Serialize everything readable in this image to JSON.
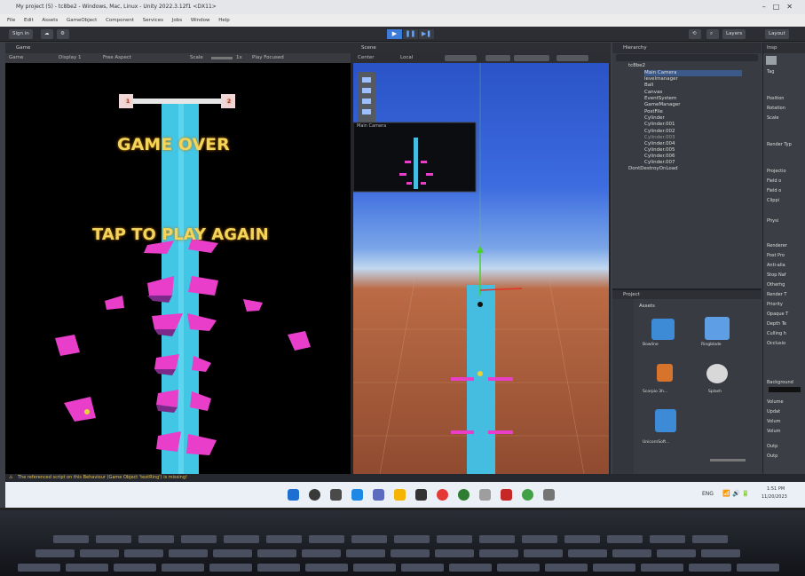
{
  "window": {
    "title": "My project (5) - tc8be2 - Windows, Mac, Linux - Unity 2022.3.12f1 <DX11>"
  },
  "menu": [
    "File",
    "Edit",
    "Assets",
    "GameObject",
    "Component",
    "Services",
    "Jobs",
    "Window",
    "Help"
  ],
  "toolbar": {
    "sign_in": "Sign in",
    "layers": "Layers",
    "layout": "Layout"
  },
  "game": {
    "tab": "Game",
    "display_mode": "Game",
    "display": "Display 1",
    "aspect": "Free Aspect",
    "scale_label": "Scale",
    "scale_value": "1x",
    "play_focused": "Play Focused",
    "game_over": "GAME OVER",
    "tap_again": "TAP TO PLAY AGAIN",
    "marker_left": "1",
    "marker_right": "2"
  },
  "scene": {
    "tab": "Scene",
    "pivot": "Center",
    "space": "Local",
    "camera_preview": "Main Camera"
  },
  "hierarchy": {
    "tab": "Hierarchy",
    "items": [
      "tc8be2",
      "Main Camera",
      "levelmanager",
      "Ball",
      "Canvas",
      "EventSystem",
      "GameManager",
      "PostFile",
      "Cylinder",
      "Cylinder.001",
      "Cylinder.002",
      "Cylinder.003",
      "Cylinder.004",
      "Cylinder.005",
      "Cylinder.006",
      "Cylinder.007",
      "DontDestroyOnLoad"
    ]
  },
  "project": {
    "tab": "Project",
    "breadcrumb": "Assets",
    "assets": [
      "Bowline",
      "Ringblade",
      "Scorpio 3h...",
      "Splash",
      "UnicornSoft..."
    ]
  },
  "inspector": {
    "tab": "Insp",
    "tag_label": "Tag",
    "rows": [
      "Position",
      "Rotation",
      "Scale",
      "Render Typ",
      "Projectio",
      "Field o",
      "Field o",
      "Clippi",
      "Physi",
      "Renderer",
      "Post Pro",
      "Anti-alia",
      "Stop Naf",
      "Otherhg",
      "Render T",
      "Priority",
      "Opaque T",
      "Depth Te",
      "Culling h",
      "Occlusio",
      "Background",
      "Volume",
      "Updat",
      "Volum",
      "Volum",
      "Outp",
      "Outp"
    ]
  },
  "console": {
    "message": "The referenced script on this Behaviour (Game Object 'textRing') is missing!"
  },
  "taskbar": {
    "lang": "ENG",
    "time": "1:51 PM",
    "date": "11/20/2023"
  }
}
